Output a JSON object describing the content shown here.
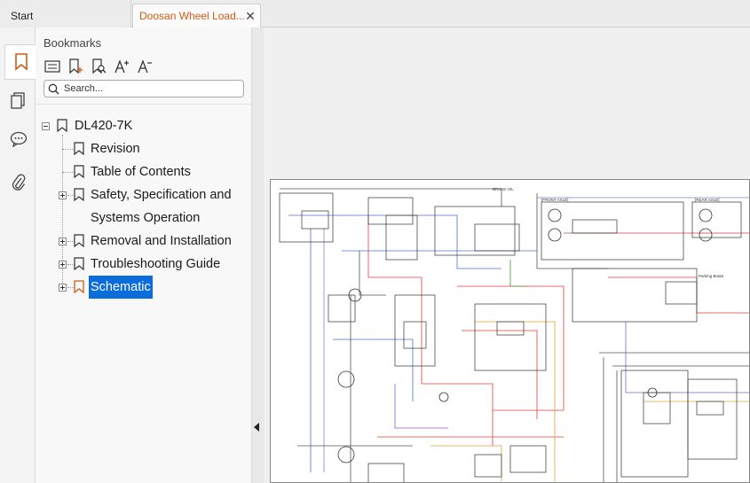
{
  "tabs": [
    {
      "label": "Start"
    },
    {
      "label": "Doosan Wheel Load..."
    }
  ],
  "tab_close_glyph": "✕",
  "rail": [
    {
      "icon": "bookmark-icon",
      "active": true
    },
    {
      "icon": "pages-icon"
    },
    {
      "icon": "comment-icon"
    },
    {
      "icon": "attachment-icon"
    }
  ],
  "bookmarks": {
    "title": "Bookmarks",
    "toolbar": [
      "bookmark-options-icon",
      "add-bookmark-icon",
      "find-bookmark-icon",
      "text-larger-icon",
      "text-smaller-icon"
    ],
    "search_placeholder": "Search...",
    "root": "DL420-7K",
    "items": [
      {
        "label": "Revision"
      },
      {
        "label": "Table of Contents"
      },
      {
        "label": "Safety, Specification and"
      },
      {
        "label": "Systems Operation"
      },
      {
        "label": "Removal and Installation"
      },
      {
        "label": "Troubleshooting Guide"
      },
      {
        "label": "Schematic"
      }
    ]
  },
  "document": {
    "labels": {
      "front_axle": "[FRONT AXLE]",
      "rear_axle": "[REAR AXLE]",
      "brake_oil": "BRAKE OIL",
      "parking_brake": "Parking Brake"
    }
  },
  "colors": {
    "accent": "#d35a14",
    "selection": "#0a6dd9",
    "wire_red": "#d94040",
    "wire_blue": "#5070c8",
    "wire_orange": "#e0a040",
    "wire_purple": "#9060c0"
  }
}
